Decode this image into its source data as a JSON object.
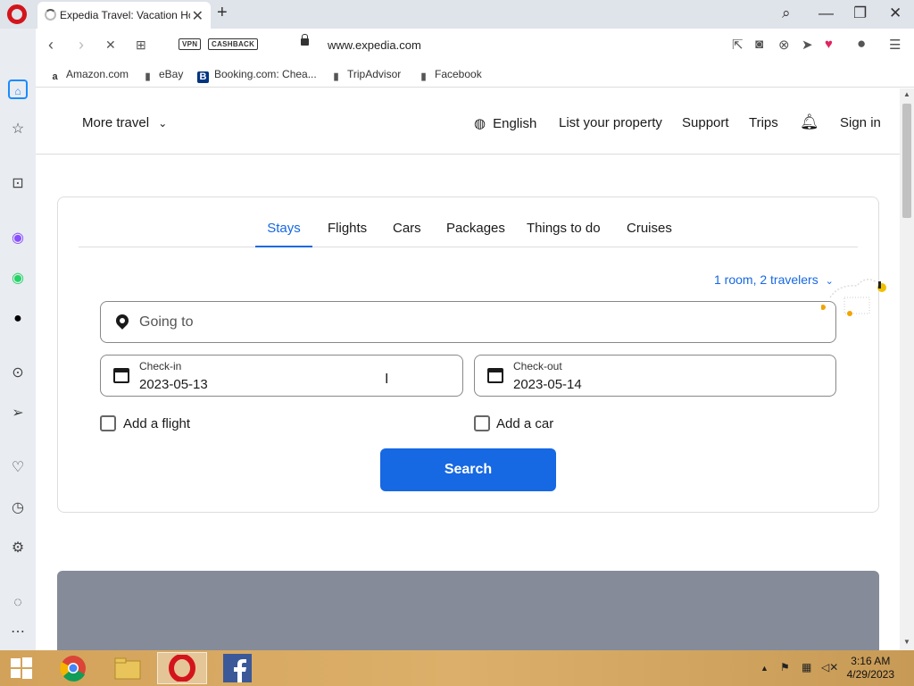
{
  "browser": {
    "tab_title": "Expedia Travel: Vacation Homes, Hotels, Car Rentals, Flights & More",
    "vpn_label": "VPN",
    "cashback_label": "CASHBACK",
    "url": "www.expedia.com",
    "bookmarks": [
      "Amazon.com",
      "eBay",
      "Booking.com: Chea...",
      "TripAdvisor",
      "Facebook"
    ]
  },
  "header": {
    "more_travel": "More travel",
    "language": "English",
    "list_property": "List your property",
    "support": "Support",
    "trips": "Trips",
    "sign_in": "Sign in"
  },
  "search": {
    "tabs": [
      "Stays",
      "Flights",
      "Cars",
      "Packages",
      "Things to do",
      "Cruises"
    ],
    "active_tab": "Stays",
    "travelers": "1 room, 2 travelers",
    "going_to_placeholder": "Going to",
    "checkin_label": "Check-in",
    "checkin_value": "2023-05-13",
    "checkout_label": "Check-out",
    "checkout_value": "2023-05-14",
    "add_flight": "Add a flight",
    "add_car": "Add a car",
    "search_button": "Search"
  },
  "taskbar": {
    "time": "3:16 AM",
    "date": "4/29/2023"
  },
  "colors": {
    "accent": "#1668e3",
    "opera_red": "#d4141c"
  }
}
